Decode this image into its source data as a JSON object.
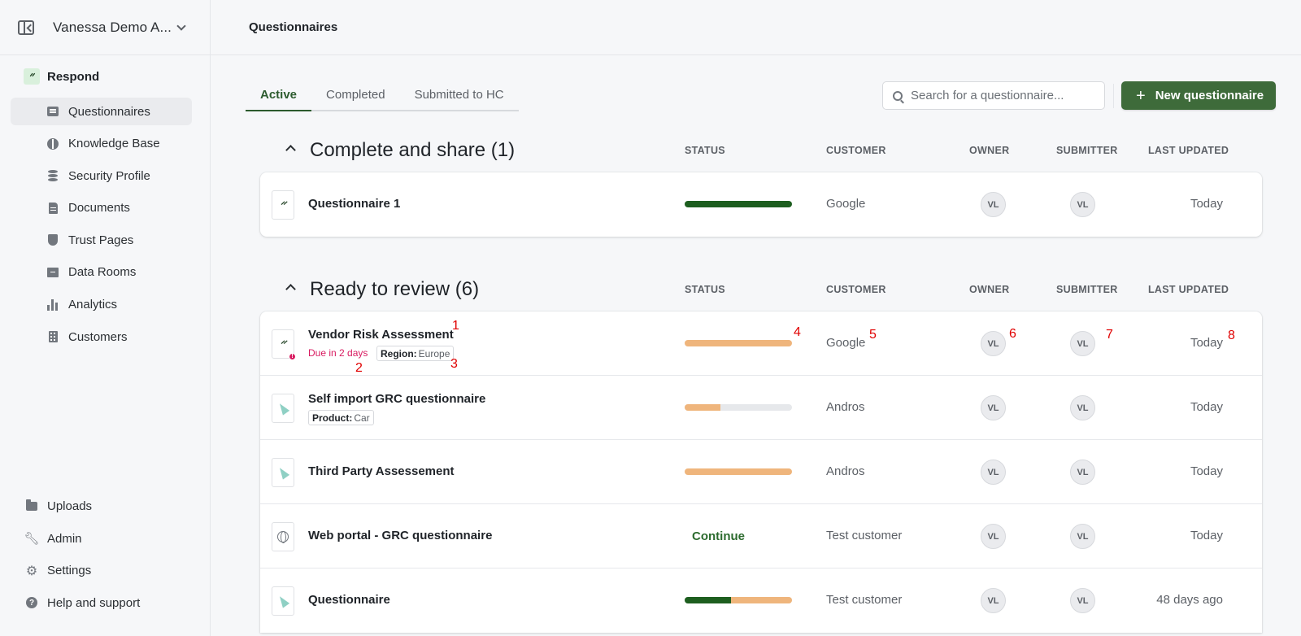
{
  "workspace": {
    "name": "Vanessa Demo A..."
  },
  "sidebar": {
    "section_label": "Respond",
    "items": [
      {
        "label": "Questionnaires",
        "icon": "questionnaire-icon",
        "active": true
      },
      {
        "label": "Knowledge Base",
        "icon": "brain-icon"
      },
      {
        "label": "Security Profile",
        "icon": "database-icon"
      },
      {
        "label": "Documents",
        "icon": "document-icon"
      },
      {
        "label": "Trust Pages",
        "icon": "shield-icon"
      },
      {
        "label": "Data Rooms",
        "icon": "archive-icon"
      },
      {
        "label": "Analytics",
        "icon": "bar-chart-icon"
      },
      {
        "label": "Customers",
        "icon": "building-icon"
      }
    ],
    "bottom_items": [
      {
        "label": "Uploads",
        "icon": "folder-icon"
      },
      {
        "label": "Admin",
        "icon": "wrench-icon"
      },
      {
        "label": "Settings",
        "icon": "gear-icon"
      },
      {
        "label": "Help and support",
        "icon": "help-icon"
      }
    ]
  },
  "header": {
    "title": "Questionnaires"
  },
  "tabs": [
    {
      "label": "Active",
      "active": true
    },
    {
      "label": "Completed"
    },
    {
      "label": "Submitted to HC"
    }
  ],
  "search": {
    "placeholder": "Search for a questionnaire..."
  },
  "new_button": {
    "label": "New questionnaire"
  },
  "columns": {
    "status": "STATUS",
    "customer": "CUSTOMER",
    "owner": "OWNER",
    "submitter": "SUBMITTER",
    "last_updated": "LAST UPDATED"
  },
  "sections": [
    {
      "title": "Complete and share (1)",
      "rows": [
        {
          "name": "Questionnaire 1",
          "icon": "respond-logo-icon",
          "progress_done": 1.0,
          "progress_pending": 0.0,
          "customer": "Google",
          "owner": "VL",
          "submitter": "VL",
          "updated": "Today"
        }
      ]
    },
    {
      "title": "Ready to review (6)",
      "rows": [
        {
          "name": "Vendor Risk Assessment",
          "icon": "respond-logo-icon",
          "alert": "!",
          "due": "Due in 2 days",
          "tag_key": "Region:",
          "tag_value": "Europe",
          "progress_done": 0.0,
          "progress_pending": 1.0,
          "customer": "Google",
          "owner": "VL",
          "submitter": "VL",
          "updated": "Today"
        },
        {
          "name": "Self import GRC questionnaire",
          "icon": "cursor-icon",
          "tag_key": "Product:",
          "tag_value": "Car",
          "progress_done": 0.0,
          "progress_pending": 0.33,
          "customer": "Andros",
          "owner": "VL",
          "submitter": "VL",
          "updated": "Today"
        },
        {
          "name": "Third Party Assessement",
          "icon": "cursor-icon",
          "progress_done": 0.0,
          "progress_pending": 1.0,
          "customer": "Andros",
          "owner": "VL",
          "submitter": "VL",
          "updated": "Today"
        },
        {
          "name": "Web portal - GRC questionnaire",
          "icon": "globe-icon",
          "continue_label": "Continue",
          "customer": "Test customer",
          "owner": "VL",
          "submitter": "VL",
          "updated": "Today"
        },
        {
          "name": "Questionnaire",
          "icon": "cursor-icon",
          "progress_done": 0.43,
          "progress_pending": 0.57,
          "customer": "Test customer",
          "owner": "VL",
          "submitter": "VL",
          "updated": "48 days ago"
        }
      ]
    }
  ],
  "annotation_markers": [
    "1",
    "2",
    "3",
    "4",
    "5",
    "6",
    "7",
    "8"
  ],
  "colors": {
    "accent": "#3e6b3a",
    "done": "#1d5e1f",
    "pending": "#efb57c",
    "track": "#e6e8eb",
    "due": "#d81b60",
    "marker": "#e00000"
  }
}
